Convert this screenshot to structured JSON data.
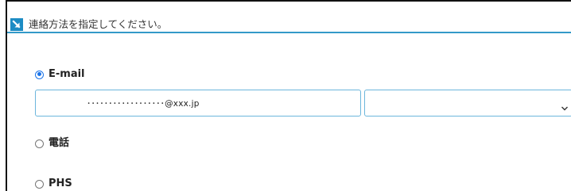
{
  "section": {
    "title": "連絡方法を指定してください。",
    "icon": "arrow-down-right-icon",
    "accent_color": "#1d8cc4"
  },
  "contact_options": [
    {
      "label": "E-mail",
      "selected": true
    },
    {
      "label": "電話",
      "selected": false
    },
    {
      "label": "PHS",
      "selected": false
    }
  ],
  "email": {
    "value": "･･････････････････@xxx.jp",
    "domain_selected": ""
  }
}
